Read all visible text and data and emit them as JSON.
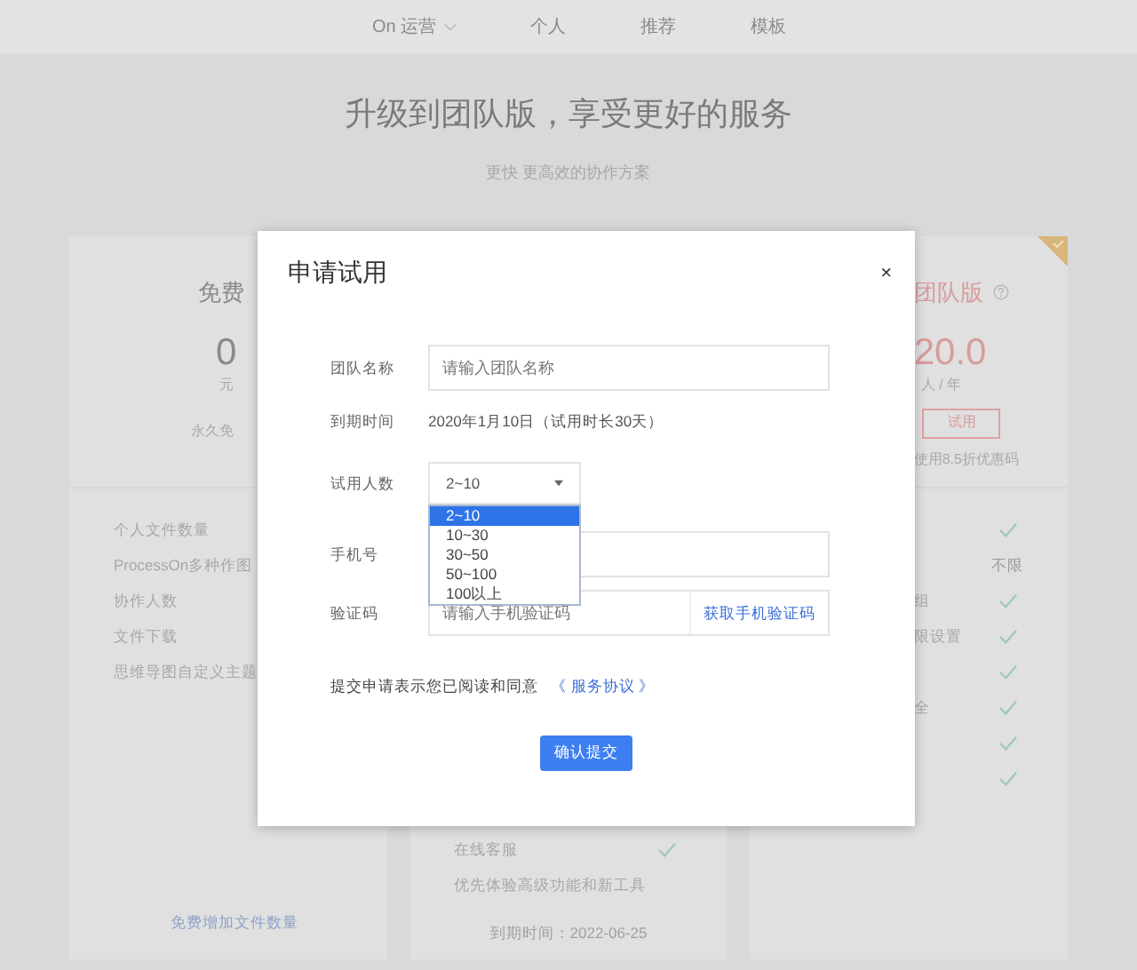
{
  "nav": {
    "items": [
      {
        "label": "On 运营",
        "dropdown": true
      },
      {
        "label": "个人",
        "dropdown": false
      },
      {
        "label": "推荐",
        "dropdown": false
      },
      {
        "label": "模板",
        "dropdown": false
      }
    ]
  },
  "hero": {
    "title": "升级到团队版，享受更好的服务",
    "subtitle": "更快 更高效的协作方案"
  },
  "free_plan": {
    "name": "免费",
    "price": "0",
    "unit": "元",
    "note": "永久免",
    "features": [
      "个人文件数量",
      "ProcessOn多种作图",
      "协作人数",
      "文件下载",
      "思维导图自定义主题"
    ],
    "link": "免费增加文件数量"
  },
  "middle_plan": {
    "features": [
      {
        "label": "在线客服",
        "kind": "check"
      },
      {
        "label": "优先体验高级功能和新工具",
        "kind": "plain"
      }
    ],
    "expiry": "到期时间：2022-06-25"
  },
  "team_plan": {
    "name": "团队版",
    "price": "20.0",
    "unit": "人 / 年",
    "trial_button": "试用",
    "coupon": "使用8.5折优惠码",
    "recommended": true,
    "features": [
      {
        "kind": "check"
      },
      {
        "kind": "text",
        "value": "不限"
      },
      {
        "kind": "check",
        "label": "组"
      },
      {
        "kind": "check",
        "label": "限设置"
      },
      {
        "kind": "check"
      },
      {
        "kind": "check",
        "label": "全"
      },
      {
        "kind": "check"
      },
      {
        "kind": "check"
      }
    ]
  },
  "dialog": {
    "title": "申请试用",
    "close": "×",
    "fields": [
      {
        "kind": "input",
        "label": "团队名称",
        "placeholder": "请输入团队名称"
      },
      {
        "kind": "text",
        "label": "到期时间",
        "value": "2020年1月10日（试用时长30天）"
      },
      {
        "kind": "select",
        "label": "试用人数",
        "value": "2~10",
        "expanded": true,
        "options": [
          {
            "label": "2~10",
            "selected": true
          },
          {
            "label": "10~30",
            "selected": false
          },
          {
            "label": "30~50",
            "selected": false
          },
          {
            "label": "50~100",
            "selected": false
          },
          {
            "label": "100以上",
            "selected": false
          }
        ]
      },
      {
        "kind": "input",
        "label": "手机号"
      },
      {
        "kind": "code",
        "label": "验证码",
        "placeholder": "请输入手机验证码",
        "action": "获取手机验证码"
      }
    ],
    "agreement": {
      "text": "提交申请表示您已阅读和同意",
      "link": "《 服务协议 》"
    },
    "submit": "确认提交"
  }
}
